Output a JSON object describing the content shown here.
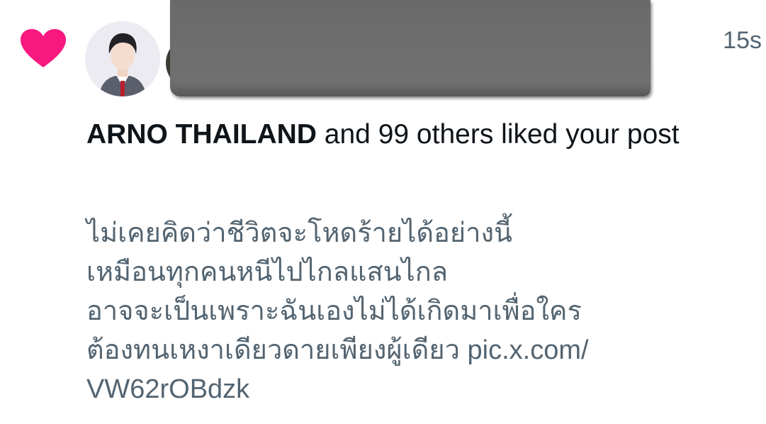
{
  "notification": {
    "icon": "heart-icon",
    "icon_color": "#f91880",
    "timestamp": "15s",
    "actor_name": "ARNO THAILAND",
    "action_text": " and 99 others liked your post"
  },
  "post": {
    "lines": [
      "ไม่เคยคิดว่าชีวิตจะโหดร้ายได้อย่างนี้",
      "เหมือนทุกคนหนีไปไกลแสนไกล",
      "อาจจะเป็นเพราะฉันเองไม่ได้เกิดมาเพื่อใคร",
      "ต้องทนเหงาเดียวดายเพียงผู้เดียว pic.x.com/",
      "VW62rOBdzk"
    ]
  },
  "colors": {
    "heart": "#f91880",
    "primary_text": "#0f1419",
    "secondary_text": "#536471"
  }
}
